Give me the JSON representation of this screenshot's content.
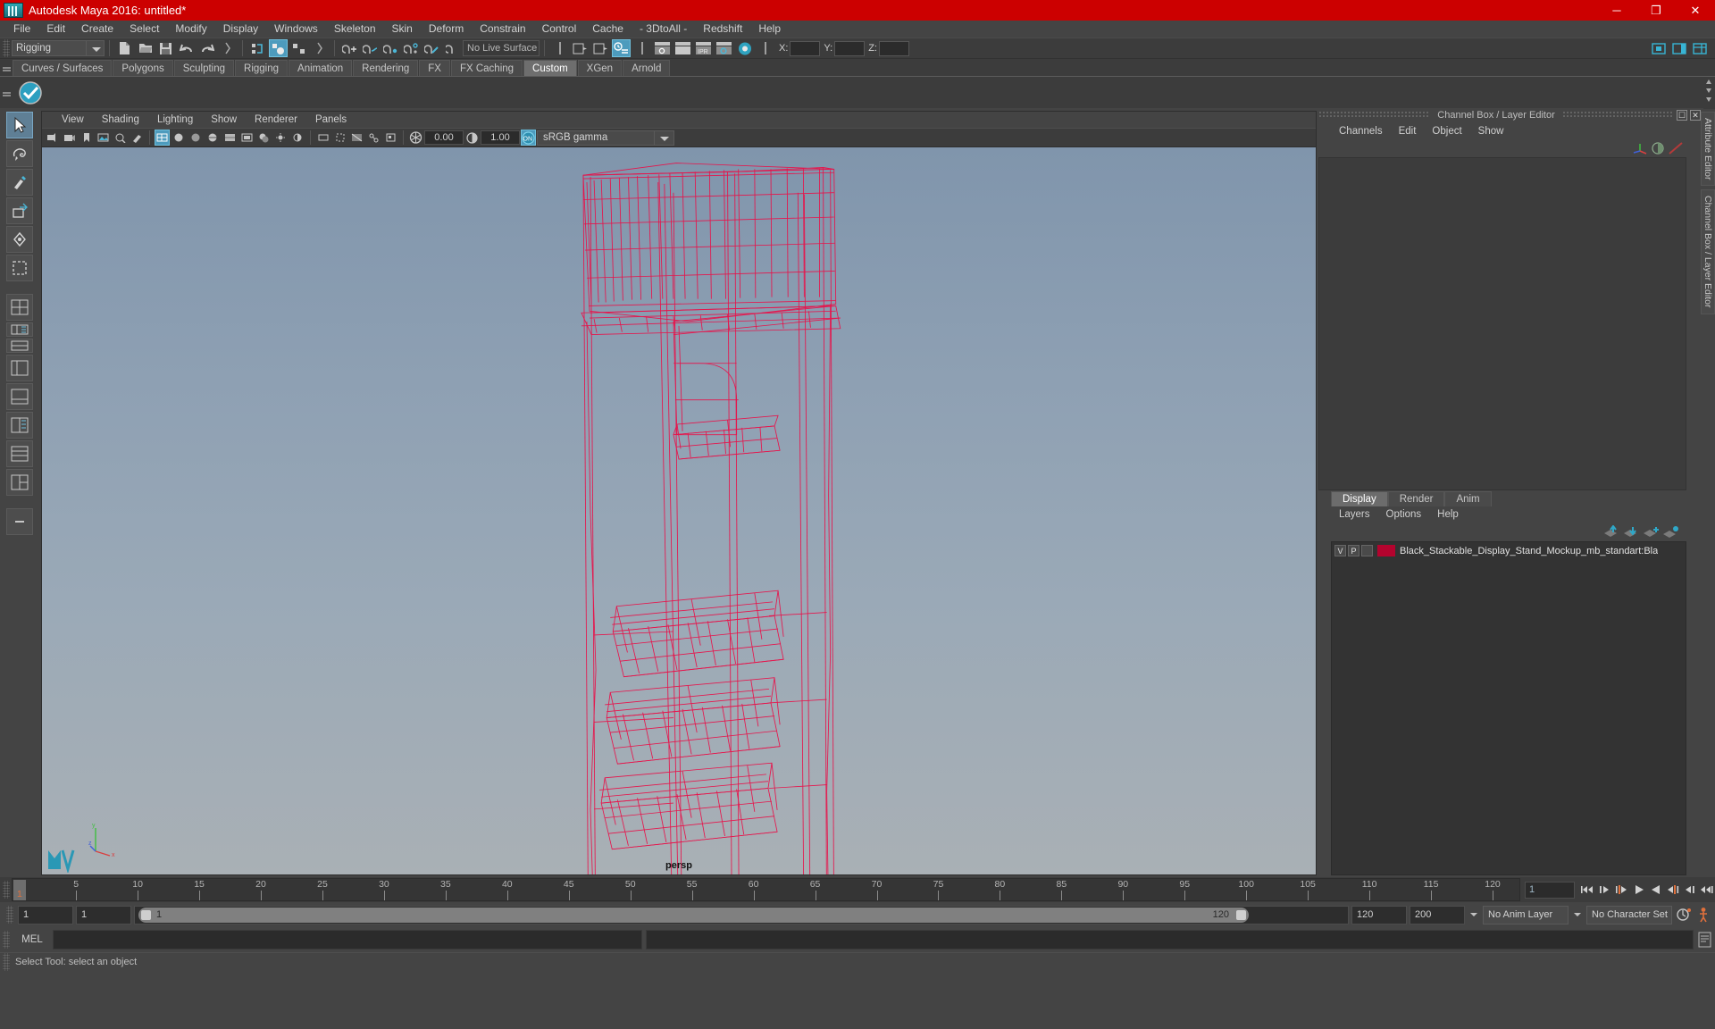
{
  "window": {
    "title": "Autodesk Maya 2016: untitled*",
    "minimize": "─",
    "maximize": "❐",
    "close": "✕",
    "accent_red": "#cc0000"
  },
  "menubar": {
    "items": [
      {
        "label": "File"
      },
      {
        "label": "Edit"
      },
      {
        "label": "Create"
      },
      {
        "label": "Select"
      },
      {
        "label": "Modify"
      },
      {
        "label": "Display"
      },
      {
        "label": "Windows"
      },
      {
        "label": "Skeleton"
      },
      {
        "label": "Skin"
      },
      {
        "label": "Deform"
      },
      {
        "label": "Constrain"
      },
      {
        "label": "Control"
      },
      {
        "label": "Cache"
      },
      {
        "label": "- 3DtoAll -"
      },
      {
        "label": "Redshift"
      },
      {
        "label": "Help"
      }
    ]
  },
  "statusline": {
    "menu_set": "Rigging",
    "live_surface": "No Live Surface",
    "axis": {
      "x_label": "X:",
      "y_label": "Y:",
      "z_label": "Z:",
      "x_value": "",
      "y_value": "",
      "z_value": ""
    }
  },
  "shelf": {
    "tabs": [
      {
        "label": "Curves / Surfaces",
        "active": false
      },
      {
        "label": "Polygons",
        "active": false
      },
      {
        "label": "Sculpting",
        "active": false
      },
      {
        "label": "Rigging",
        "active": false
      },
      {
        "label": "Animation",
        "active": false
      },
      {
        "label": "Rendering",
        "active": false
      },
      {
        "label": "FX",
        "active": false
      },
      {
        "label": "FX Caching",
        "active": false
      },
      {
        "label": "Custom",
        "active": true
      },
      {
        "label": "XGen",
        "active": false
      },
      {
        "label": "Arnold",
        "active": false
      }
    ]
  },
  "viewport": {
    "menu": [
      {
        "label": "View"
      },
      {
        "label": "Shading"
      },
      {
        "label": "Lighting"
      },
      {
        "label": "Show"
      },
      {
        "label": "Renderer"
      },
      {
        "label": "Panels"
      }
    ],
    "exposure": "0.00",
    "gamma": "1.00",
    "gamma_toggle": "ON",
    "color_space": "sRGB gamma",
    "camera_label": "persp",
    "wireframe_color": "#e8124a",
    "axis_labels": {
      "x": "x",
      "y": "y",
      "z": "z"
    }
  },
  "channelbox": {
    "panel_title": "Channel Box / Layer Editor",
    "menu": [
      {
        "label": "Channels"
      },
      {
        "label": "Edit"
      },
      {
        "label": "Object"
      },
      {
        "label": "Show"
      }
    ]
  },
  "layer_editor": {
    "tabs": [
      {
        "label": "Display",
        "active": true
      },
      {
        "label": "Render",
        "active": false
      },
      {
        "label": "Anim",
        "active": false
      }
    ],
    "menu": [
      {
        "label": "Layers"
      },
      {
        "label": "Options"
      },
      {
        "label": "Help"
      }
    ],
    "layers": [
      {
        "visible": "V",
        "playback": "P",
        "type": "",
        "color": "#b4032e",
        "name": "Black_Stackable_Display_Stand_Mockup_mb_standart:Bla"
      }
    ]
  },
  "right_tabs": [
    {
      "label": "Attribute Editor"
    },
    {
      "label": "Channel Box / Layer Editor"
    }
  ],
  "timeline": {
    "start": 1,
    "end": 120,
    "current_frame": "1",
    "ticks": [
      5,
      10,
      15,
      20,
      25,
      30,
      35,
      40,
      45,
      50,
      55,
      60,
      65,
      70,
      75,
      80,
      85,
      90,
      95,
      100,
      105,
      110,
      115,
      120
    ],
    "current_marker_label": "1",
    "frame_field": "1"
  },
  "range_slider": {
    "anim_start": "1",
    "range_start": "1",
    "range_end_label": "120",
    "range_start_label": "1",
    "range_end": "120",
    "anim_end": "200",
    "anim_layer": "No Anim Layer",
    "character_set": "No Character Set"
  },
  "command_line": {
    "language": "MEL",
    "input_value": "",
    "output_value": ""
  },
  "help_line": {
    "text": "Select Tool: select an object"
  }
}
